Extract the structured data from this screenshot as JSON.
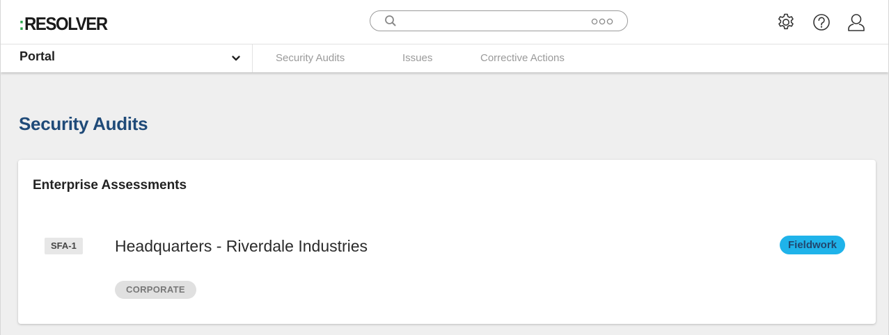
{
  "header": {
    "logo_colon": ":",
    "logo_text": "RESOLVER",
    "search_placeholder": "",
    "icons": [
      "gear-icon",
      "help-icon",
      "user-icon"
    ]
  },
  "nav": {
    "portal_label": "Portal",
    "tabs": [
      {
        "label": "Security Audits"
      },
      {
        "label": "Issues"
      },
      {
        "label": "Corrective Actions"
      }
    ]
  },
  "main": {
    "page_title": "Security Audits",
    "card": {
      "title": "Enterprise Assessments",
      "records": [
        {
          "id": "SFA-1",
          "name": "Headquarters - Riverdale Industries",
          "tag": "CORPORATE",
          "status": "Fieldwork"
        }
      ]
    }
  },
  "colors": {
    "brand_green": "#2ea84f",
    "title_blue": "#1f4a78",
    "status_blue": "#1fb3ea",
    "page_bg": "#efefef"
  }
}
